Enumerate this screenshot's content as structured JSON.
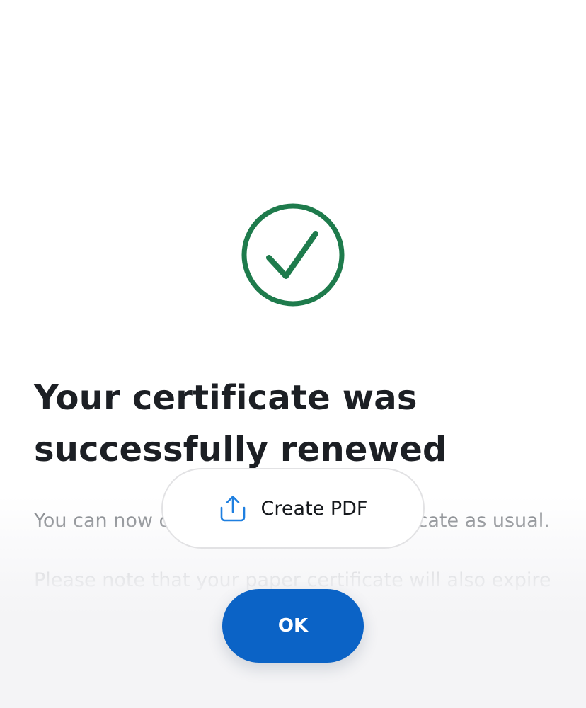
{
  "colors": {
    "success_green": "#1e7b4c",
    "primary_blue": "#0b63c6",
    "pdf_icon_blue": "#1e7fe0",
    "title_text": "#1c1f24",
    "body_text": "#6f7378"
  },
  "status": {
    "icon": "checkmark-circle-icon"
  },
  "content": {
    "title": "Your certificate was successfully renewed",
    "paragraph_1": "You can now continue to use your certificate as usual.",
    "paragraph_2": "Please note that your paper certificate will also expire"
  },
  "actions": {
    "create_pdf_label": "Create PDF",
    "create_pdf_icon": "share-upload-icon",
    "ok_label": "OK"
  }
}
